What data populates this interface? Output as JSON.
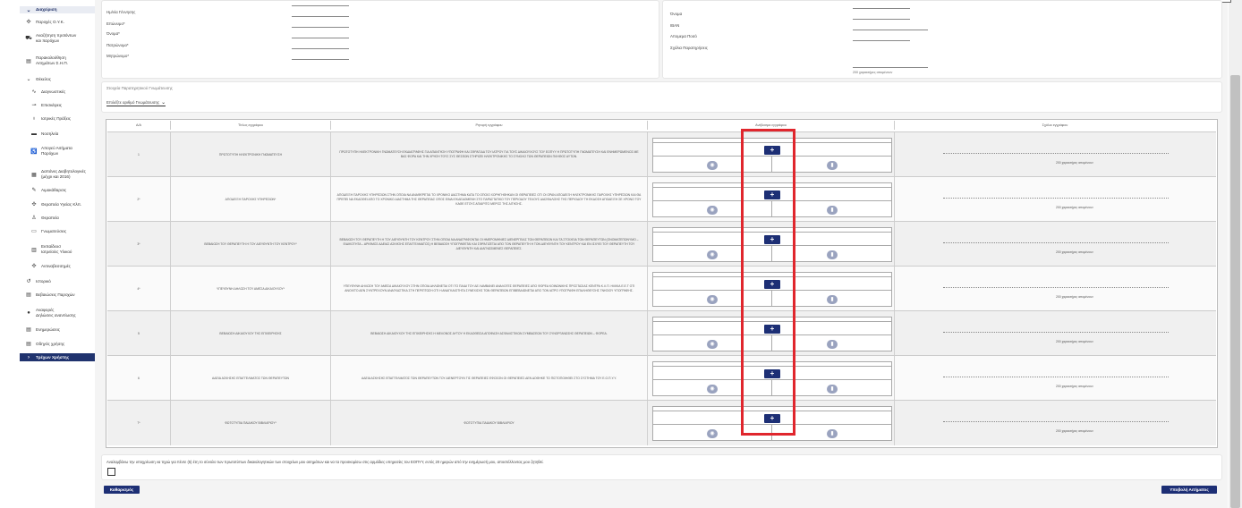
{
  "sidebar": {
    "section": "Διαχείριση",
    "items": [
      {
        "icon": "gear-icon",
        "label": "Παροχές Ο.Υ.Κ.",
        "sub": false
      },
      {
        "icon": "truck-icon",
        "label": "Αναζήτηση προϊόντων\nκαι παρόχων",
        "sub": false
      },
      {
        "icon": "doc-icon",
        "label": "Παρακολούθηση\nΑιτημάτων Σ.Η.Π.",
        "sub": false
      },
      {
        "icon": "chevron-down-icon",
        "label": "Θέκελος",
        "sub": false
      },
      {
        "icon": "pulse-icon",
        "label": "Διαγνωστικές",
        "sub": true
      },
      {
        "icon": "pill-icon",
        "label": "Επισκέψεις",
        "sub": true
      },
      {
        "icon": "stethoscope-icon",
        "label": "Ιατρικές Πράξεις",
        "sub": true
      },
      {
        "icon": "bed-icon",
        "label": "Νοσηλεία",
        "sub": true
      },
      {
        "icon": "person-icon",
        "label": "Απογεύ Αιτήματα\nΠαρόχων",
        "sub": true
      },
      {
        "icon": "calendar-icon",
        "label": "Δαπάνες Διαβητολογικές\n(μέχρι και 2016)",
        "sub": true
      },
      {
        "icon": "syringe-icon",
        "label": "Αιμοκάθαρσις",
        "sub": true
      },
      {
        "icon": "crutch-icon",
        "label": "Θεραπεία Υγείας Κλπ.",
        "sub": true
      },
      {
        "icon": "walker-icon",
        "label": "Θεραπεία",
        "sub": true
      },
      {
        "icon": "glasses-icon",
        "label": "Γνωματεύσεις",
        "sub": true
      },
      {
        "icon": "clipboard-icon",
        "label": "Εκπαίδευσ\nΙατρείο/ες Υλικού",
        "sub": true
      },
      {
        "icon": "gear-icon",
        "label": "Αντιναβεσσημές",
        "sub": true
      },
      {
        "icon": "history-icon",
        "label": "Ιστορικό",
        "sub": false
      },
      {
        "icon": "doc-icon",
        "label": "Βεβαιώσεις Παροχών",
        "sub": false
      },
      {
        "icon": "info-icon",
        "label": "Αναφορές\nΔηλώσεις αναντίωσης",
        "sub": false
      },
      {
        "icon": "doc-icon",
        "label": "Ενημερώσεις",
        "sub": false
      },
      {
        "icon": "doc-icon",
        "label": "Οδηγός χρήσης",
        "sub": false
      }
    ],
    "active": "Τρέχων Χρήστης"
  },
  "form_left": {
    "labels": [
      "Ημ/νία Γέννησης",
      "Επώνυμο*",
      "Όνομα*",
      "Πατρώνυμο*",
      "Μητρώνυμο*"
    ]
  },
  "form_right": {
    "labels": [
      "Όνομα",
      "IBAN",
      "Απομεμα Ποσό",
      "Σχόλια Παρατηρήσεις"
    ],
    "counter": "200 χαρακτήρες απομένουν"
  },
  "comments_section": {
    "title": "Στοιχεία Παρατηρητικού Γνωμάτευσης",
    "select": "Επιλέξτε αριθμό Γνωμάτευσης"
  },
  "table": {
    "headers": [
      "Α/Α",
      "Τίτλος εγγράφου",
      "Ρητορή εγγράφου",
      "Ανέβασμα εγγράφου",
      "Σχόλιο εγγράφου"
    ],
    "rows": [
      {
        "num": "1",
        "title": "ΠΡΩΤΟΤΥΠΗ ΗΛΕΚΤΡΟΝΙΚΗ ΓΝΩΜΑΤΕΥΣΗ",
        "desc": "ΠΡΩΤΟΤΥΠΗ ΗΛΕΚΤΡΟΝΙΚΗ ΓΝΩΜΑΤΕΥΣΗ ΕΚΔΙΑΓΡΑΦΗΣ ΓΙΑ ΑΠΑΝΤΗΣΗ ΥΠΟΓΡΑΦΗ ΚΑΙ ΣΦΡΑΓΙΔΑ ΤΟΥ ΙΑΤΡΟΥ ΓΙΑ ΤΟΥΣ ΔΙΚΑΙΟΥΧΟΥΣ ΤΟΥ ΕΟΠΥΥ Η ΠΡΩΤΟΤΥΠΗ ΓΝΩΜΑΤΕΥΣΗ ΚΑΙ ΕΝΗΜΕΡΩΜΕΝΟΣ ΜΕ ΒΑΣ ΦΟΡΑ ΚΑΙ ΤΗΝ ΧΡΗΣΗ ΤΟΥΣ ΣΥΣ ΘΕΣΕΩΝ ΣΤΗΡΙΖΕΙ ΗΛΕΚΤΡΟΝΙΚΗΣ ΤΟ ΣΥΝΟΛΟ ΤΩΝ ΘΕΡΑΠΕΙΩΝ ΠΛΗΘΟΣ ΑΥΤΩΝ.",
        "counter": "200 χαρακτήρες απομένουν"
      },
      {
        "num": "2*",
        "title": "ΑΠΟΔΕΙΞΗ ΠΑΡΟΧΗΣ ΥΠΗΡΕΣΙΩΝ*",
        "desc": "ΑΠΟΔΕΙΞΗ ΠΑΡΟΧΗΣ ΥΠΗΡΕΣΙΩΝ ΣΤΗΝ ΟΠΟΙΑ ΝΑ ΑΝΑΦΕΡΕΤΑΙ ΤΟ ΧΡΟΝΙΚΟ ΔΙΑΣΤΗΜΑ ΚΑΤΑ ΤΟ ΟΠΟΙΟ ΧΟΡΗΓΗΘΗΚΑΝ ΟΙ ΘΕΡΑΠΕΙΕΣ ΟΤΙ ΟΙ ΟΡΑΝ ΑΠΟΔΕΙΞΗ ΗΛΕΚΤΡΟΝΙΚΗΣ ΠΑΡΟΧΗΣ ΥΠΗΡΕΣΙΩΝ ΚΑΙ ΘΑ ΠΡΕΠΕΙ ΝΑ ΕΚΔΟΘΕΙ ΑΠΟ ΤΟ ΧΡΟΝΙΚΟ ΔΙΑΣΤΗΜΑ ΤΗΣ ΘΕΡΑΠΕΙΑΣ ΟΠΟΣ ΕΙΝΑΙ ΕΚΔΕΔΟΜΕΝΗ ΣΤΟ ΠΑΡΑΣΤΑΤΙΚΟ ΤΟΥ ΠΕΡΙΟΔΟΥ ΤΕΛΟΥΣ ΔΙΑΣΦΑΛΙΣΗΣ ΤΗΣ ΠΕΡΙΟΔΟΥ ΤΗ ΕΚΔΟΣΗ ΑΠΟΔΕΙΞΗ ΣΕ ΧΡΟΝΟ ΤΟΥ ΚΑΘΕ ΕΤΟΥΣ ΑΠΑΙΡΙΤΟ ΜΕΡΟΣ ΤΗΣ ΑΙΤΗΣΗΣ.",
        "counter": "200 χαρακτήρες απομένουν"
      },
      {
        "num": "3*",
        "title": "ΒΕΒΑΙΩΣΗ ΤΟΥ ΘΕΡΑΠΕΥΤΗ Η ΤΟΥ ΔΙΕΥΘΥΝΤΗ ΤΟΥ ΚΕΝΤΡΟΥ*",
        "desc": "ΒΕΒΑΙΩΣΗ ΤΟΥ ΘΕΡΑΠΕΥΤΗ Η ΤΟΥ ΔΙΕΥΘΥΝΤΗ ΤΟΥ ΚΕΝΤΡΟΥ ΣΤΗΝ ΟΠΟΙΑ ΝΑ ΑΝΑΓΡΑΦΟΝΤΑΙ ΟΙ ΗΜΕΡΟΜΗΝΙΕΣ ΔΙΕΝΕΡΓΕΙΑΣ ΤΩΝ ΘΕΡΑΠΕΙΩΝ ΚΑΙ ΤΑ ΣΤΟΙΧΕΙΑ ΤΩΝ ΘΕΡΑΠΕΥΤΩΝ (ΟΝΟΜΑΤΕΠΩΝΥΜΟ – ΕΙΔΙΚΟΤΗΤΑ – ΑΡΙΘΜΟΣ ΑΔΕΙΑΣ ΑΣΚΗΣΗΣ ΕΠΑΓΓΕΛΜΑΤΟΣ) Η ΒΕΒΑΙΩΣΗ ΥΠΟΓΡΑΦΕΤΑΙ ΚΑΙ ΣΦΡΑΓΙΖΕΤΑΙ ΑΠΟ ΤΟΝ ΘΕΡΑΠΕΥΤΗ Η ΤΟΝ ΔΙΕΥΘΥΝΤΗ ΤΟΥ ΚΕΝΤΡΟΥ ΚΑΙ ΕΝ ΙΣΧΥΕΙ ΤΟΥ ΘΕΡΑΠΕΥΤΗ ΤΟΥ ΔΙΕΥΘΥΝΤΗ ΚΑΙ ΔΙΑΓΝΩΣΜΕΝΕΣ ΘΕΡΑΠΕΙΕΣ.",
        "counter": "200 χαρακτήρες απομένουν"
      },
      {
        "num": "4*",
        "title": "ΥΠΕΥΘΥΝΗ ΔΗΛΩΣΗ ΤΟΥ ΑΜΕΣΑ ΔΙΚΑΙΟΥΧΟΥ*",
        "desc": "ΥΠΕΥΘΥΝΗ ΔΗΛΩΣΗ ΤΟΥ ΑΜΕΣΑ ΔΙΚΑΙΟΥΧΟΥ ΣΤΗΝ ΟΠΟΙΑ ΔΗΛΩΝΕΤΑΙ ΟΤΙ ΤΟ ΠΑΙΔΙ ΤΟΥ ΔΕ ΛΑΜΒΑΝΕΙ ΑΝΑΛΟΓΕΣ ΘΕΡΑΠΕΙΕΣ ΑΠΟ ΦΟΡΕΑ ΚΟΙΝΩΝΙΚΗΣ ΠΡΟΣΤΑΣΙΑΣ ΚΕΝΤΡΑ Κ.Λ.Π. ΗΛΙΚΙΑ Ε.Ε.Τ ΟΤΙ ΑΝΟΙΧΤΟ ΔΕΝ ΣΥΝΤΡΕΧΟΥΝ ΑΝΑΓΚΑΣΤΙΚΑ ΣΤΗ ΠΕΡΙΠΤΩΣΗ ΟΤΙ Η ΑΝΑΓΚΑΙΟΤΗΤΑ ΣΥΝΕΧΙΣΗΣ ΤΩΝ ΘΕΡΑΠΕΙΩΝ ΕΠΙΒΕΒΑΙΩΝΕΤΑΙ ΑΠΟ ΤΟΝ ΙΑΤΡΟ ΥΠΟΓΡΑΦΗ ΕΠΑΛΗΘΕΥΣΗΣ ΓΝΗΣΙΟΥ ΥΠΟΓΡΑΦΗΣ.",
        "counter": "200 χαρακτήρες απομένουν"
      },
      {
        "num": "5",
        "title": "ΒΕΒΑΙΩΣΗ ΔΙΚΑΙΟΥΧΟΥ ΤΗΣ ΕΠΙΧΕΙΡΗΣΗΣ",
        "desc": "ΒΕΒΑΙΩΣΗ ΔΙΚΑΙΟΥΧΟΥ ΤΗΣ ΕΠΙΧΕΙΡΗΣΗΣ Η ΜΕΛΟΝΟΣ ΑΥΤΟΥ Η ΕΚΔΟΘΕΙΣΑ ΑΠΟΦΑΣΗ ΑΣΦΑΛΙΣΤΙΚΩΝ ΣΥΜΒΑΣΕΩΝ ΤΟΥ ΣΥΝΟΡΓΑΝΩΣΗΣ ΘΕΡΑΠΕΙΩΝ – ΦΟΡΕΑ.",
        "counter": "200 χαρακτήρες απομένουν"
      },
      {
        "num": "6",
        "title": "ΑΔΕΙΑ ΑΣΚΗΣΗΣ ΕΠΑΓΓΕΛΜΑΤΟΣ ΤΩΝ ΘΕΡΑΠΕΥΤΩΝ",
        "desc": "ΑΔΕΙΑ ΑΣΚΗΣΗΣ ΕΠΑΓΓΕΛΜΑΤΟΣ ΤΩΝ ΘΕΡΑΠΕΥΤΩΝ ΤΟΥ ΔΙΕΝΕΡΓΟΥΝ ΤΙΣ ΘΕΡΑΠΕΙΕΣ ΕΦΟΣΟΝ ΟΙ ΘΕΡΑΠΕΙΕΣ ΔΕΝ ΔΟΘΗΚΕ ΤΟ ΠΙΣΤΟΠΟΙΗΘΕΙ ΣΤΟ ΣΥΣΤΗΜΑ ΤΟΥ Ε.Ο.Π.Υ.Υ.",
        "counter": "200 χαρακτήρες απομένουν"
      },
      {
        "num": "7*",
        "title": "ΦΩΤΟΤΥΠΙΑ ΠΑΙΔΙΚΟΥ ΒΙΒΛΙΑΡΙΟΥ*",
        "desc": "ΦΩΤΟΤΥΠΙΑ ΠΑΙΔΙΚΟΥ ΒΙΒΛΙΑΡΙΟΥ",
        "counter": "200 χαρακτήρες απομένουν"
      }
    ],
    "plus_label": "+",
    "eye_glyph": "◉",
    "trash_glyph": "▮"
  },
  "consent_text": "Αναλαμβάνω την υποχρέωση να τηρώ για πέντε (5) έτη το σύνολο των πρωτοτύπων δικαιολογητικών των στοιχείων μου αιτημάτων και να τα προσκομίσω στις αρμόδιες υπηρεσίες του ΕΟΠΥΥ, εντός 20 ημερών από την ενημέρωσή μου, αποστέλλοντας μου ζητηθεί.",
  "buttons": {
    "clear": "Καθαρισμός",
    "submit": "Υποβολή Αιτήματος"
  },
  "colors": {
    "primary": "#1d2f75",
    "highlight": "#e0262d"
  }
}
